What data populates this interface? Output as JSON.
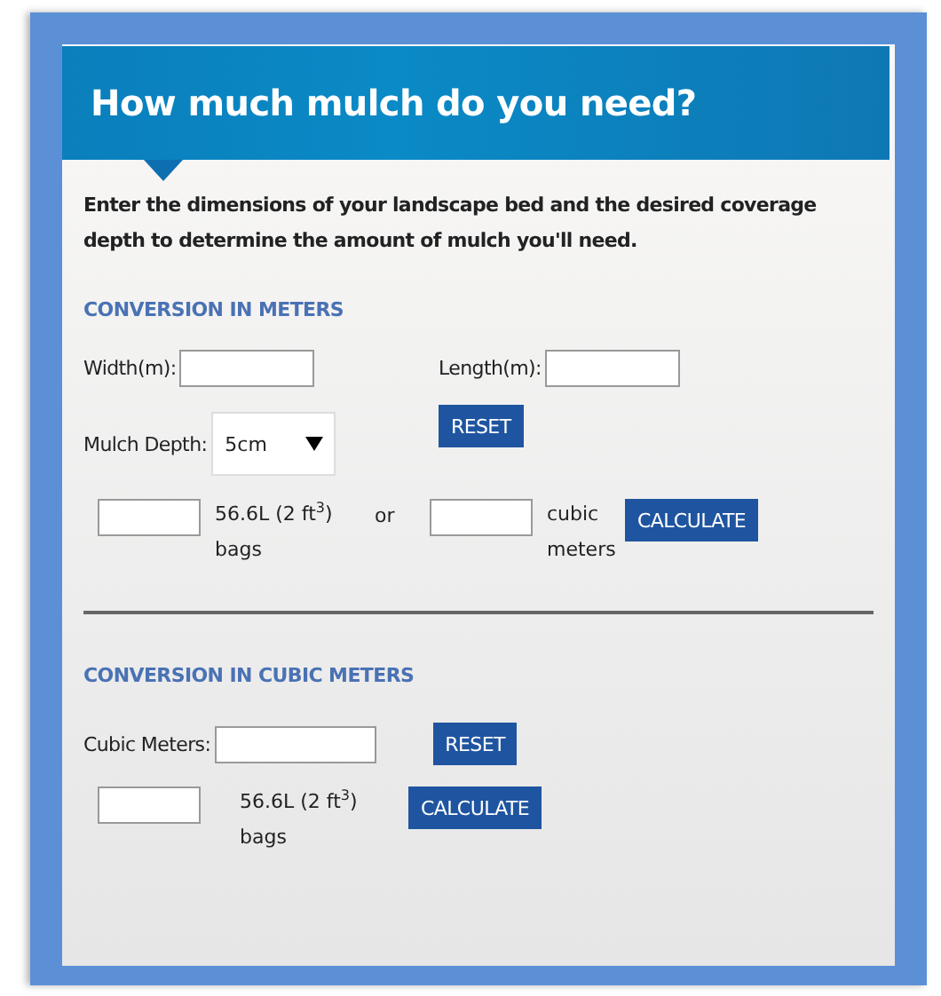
{
  "title": "How much mulch do you need?",
  "intro": "Enter the dimensions of your landscape bed and the desired coverage depth to determine the amount of mulch you'll need.",
  "meters": {
    "heading": "CONVERSION IN METERS",
    "width_label": "Width(m):",
    "length_label": "Length(m):",
    "depth_label": "Mulch Depth:",
    "depth_value": "5cm",
    "reset": "RESET",
    "bags_label": "56.6L (2 ft$^{3}$) bags",
    "or": "or",
    "cubic_label": "cubic meters",
    "calculate": "CALCULATE"
  },
  "cubic": {
    "heading": "CONVERSION IN CUBIC METERS",
    "cubic_label": "Cubic Meters:",
    "reset": "RESET",
    "bags_label": "56.6L (2 ft$^{3}$) bags",
    "calculate": "CALCULATE"
  }
}
